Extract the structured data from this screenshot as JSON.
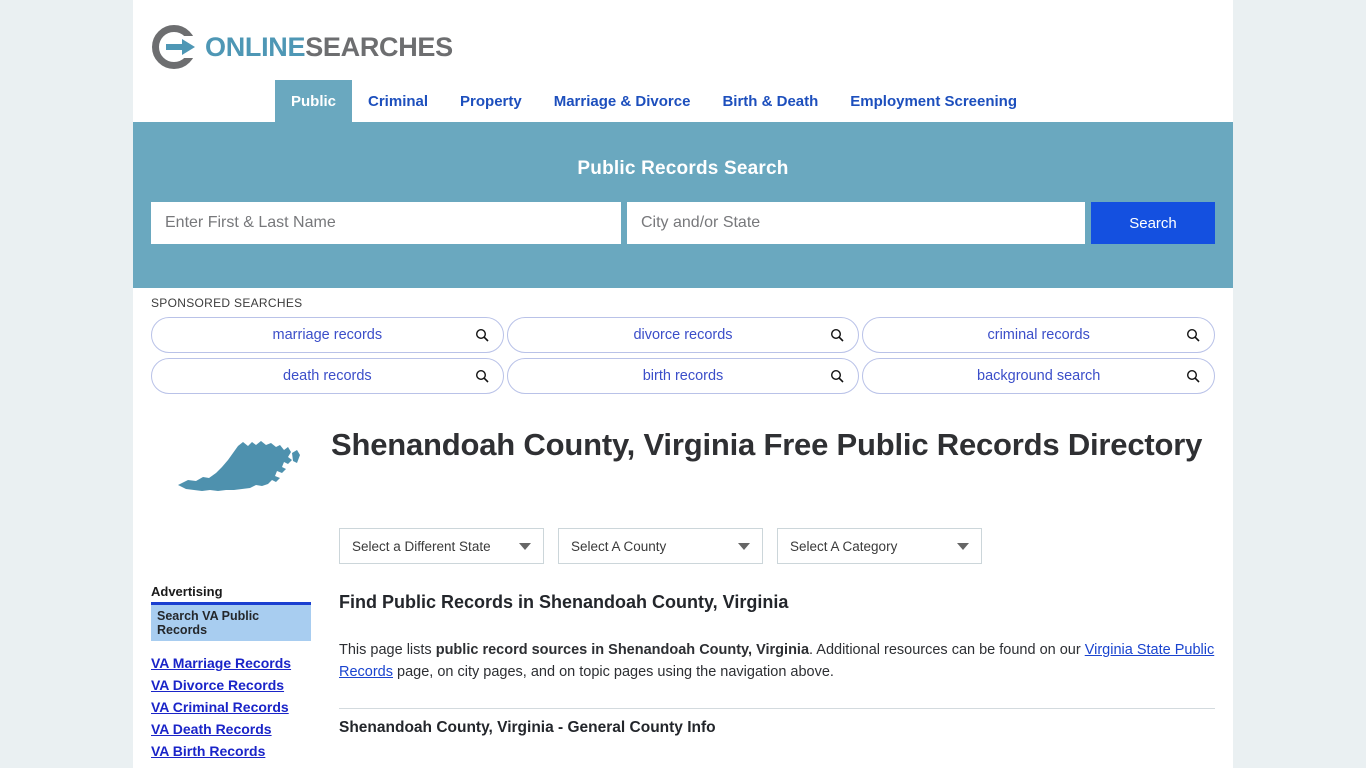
{
  "brand": {
    "name_part1": "ONLINE",
    "name_part2": "SEARCHES",
    "logo_icon": "circle-arrow-icon",
    "accent_blue": "#4e97b5",
    "accent_gray": "#6d6e70"
  },
  "nav": {
    "items": [
      {
        "label": "Public",
        "active": true
      },
      {
        "label": "Criminal",
        "active": false
      },
      {
        "label": "Property",
        "active": false
      },
      {
        "label": "Marriage & Divorce",
        "active": false
      },
      {
        "label": "Birth & Death",
        "active": false
      },
      {
        "label": "Employment Screening",
        "active": false
      }
    ]
  },
  "search": {
    "title": "Public Records Search",
    "name_value": "",
    "name_placeholder": "Enter First & Last Name",
    "city_value": "",
    "city_placeholder": "City and/or State",
    "button_label": "Search",
    "band_color": "#6aa8bf",
    "button_color": "#1450e0"
  },
  "sponsored": {
    "label": "SPONSORED SEARCHES",
    "icon": "magnifier-icon",
    "row1": [
      {
        "label": "marriage records"
      },
      {
        "label": "divorce records"
      },
      {
        "label": "criminal records"
      }
    ],
    "row2": [
      {
        "label": "death records"
      },
      {
        "label": "birth records"
      },
      {
        "label": "background search"
      }
    ]
  },
  "page": {
    "state_map_icon": "virginia-state-map-icon",
    "title": "Shenandoah County, Virginia Free Public Records Directory"
  },
  "selectors": [
    {
      "label": "Select a Different State",
      "name": "state"
    },
    {
      "label": "Select A County",
      "name": "county"
    },
    {
      "label": "Select A Category",
      "name": "category"
    }
  ],
  "sidebar": {
    "advertising_label": "Advertising",
    "highlight_label": "Search VA Public Records",
    "links": [
      "VA Marriage Records",
      "VA Divorce Records",
      "VA Criminal Records",
      "VA Death Records",
      "VA Birth Records"
    ]
  },
  "main": {
    "heading": "Find Public Records in Shenandoah County, Virginia",
    "paragraph": {
      "part1": "This page lists ",
      "bold1": "public record sources in Shenandoah County, Virginia",
      "part2": ". Additional resources can be found on our ",
      "link1": "Virginia State Public Records",
      "part3": " page, on city pages, and on topic pages using the navigation above."
    },
    "section_heading": "Shenandoah County, Virginia - General County Info"
  }
}
